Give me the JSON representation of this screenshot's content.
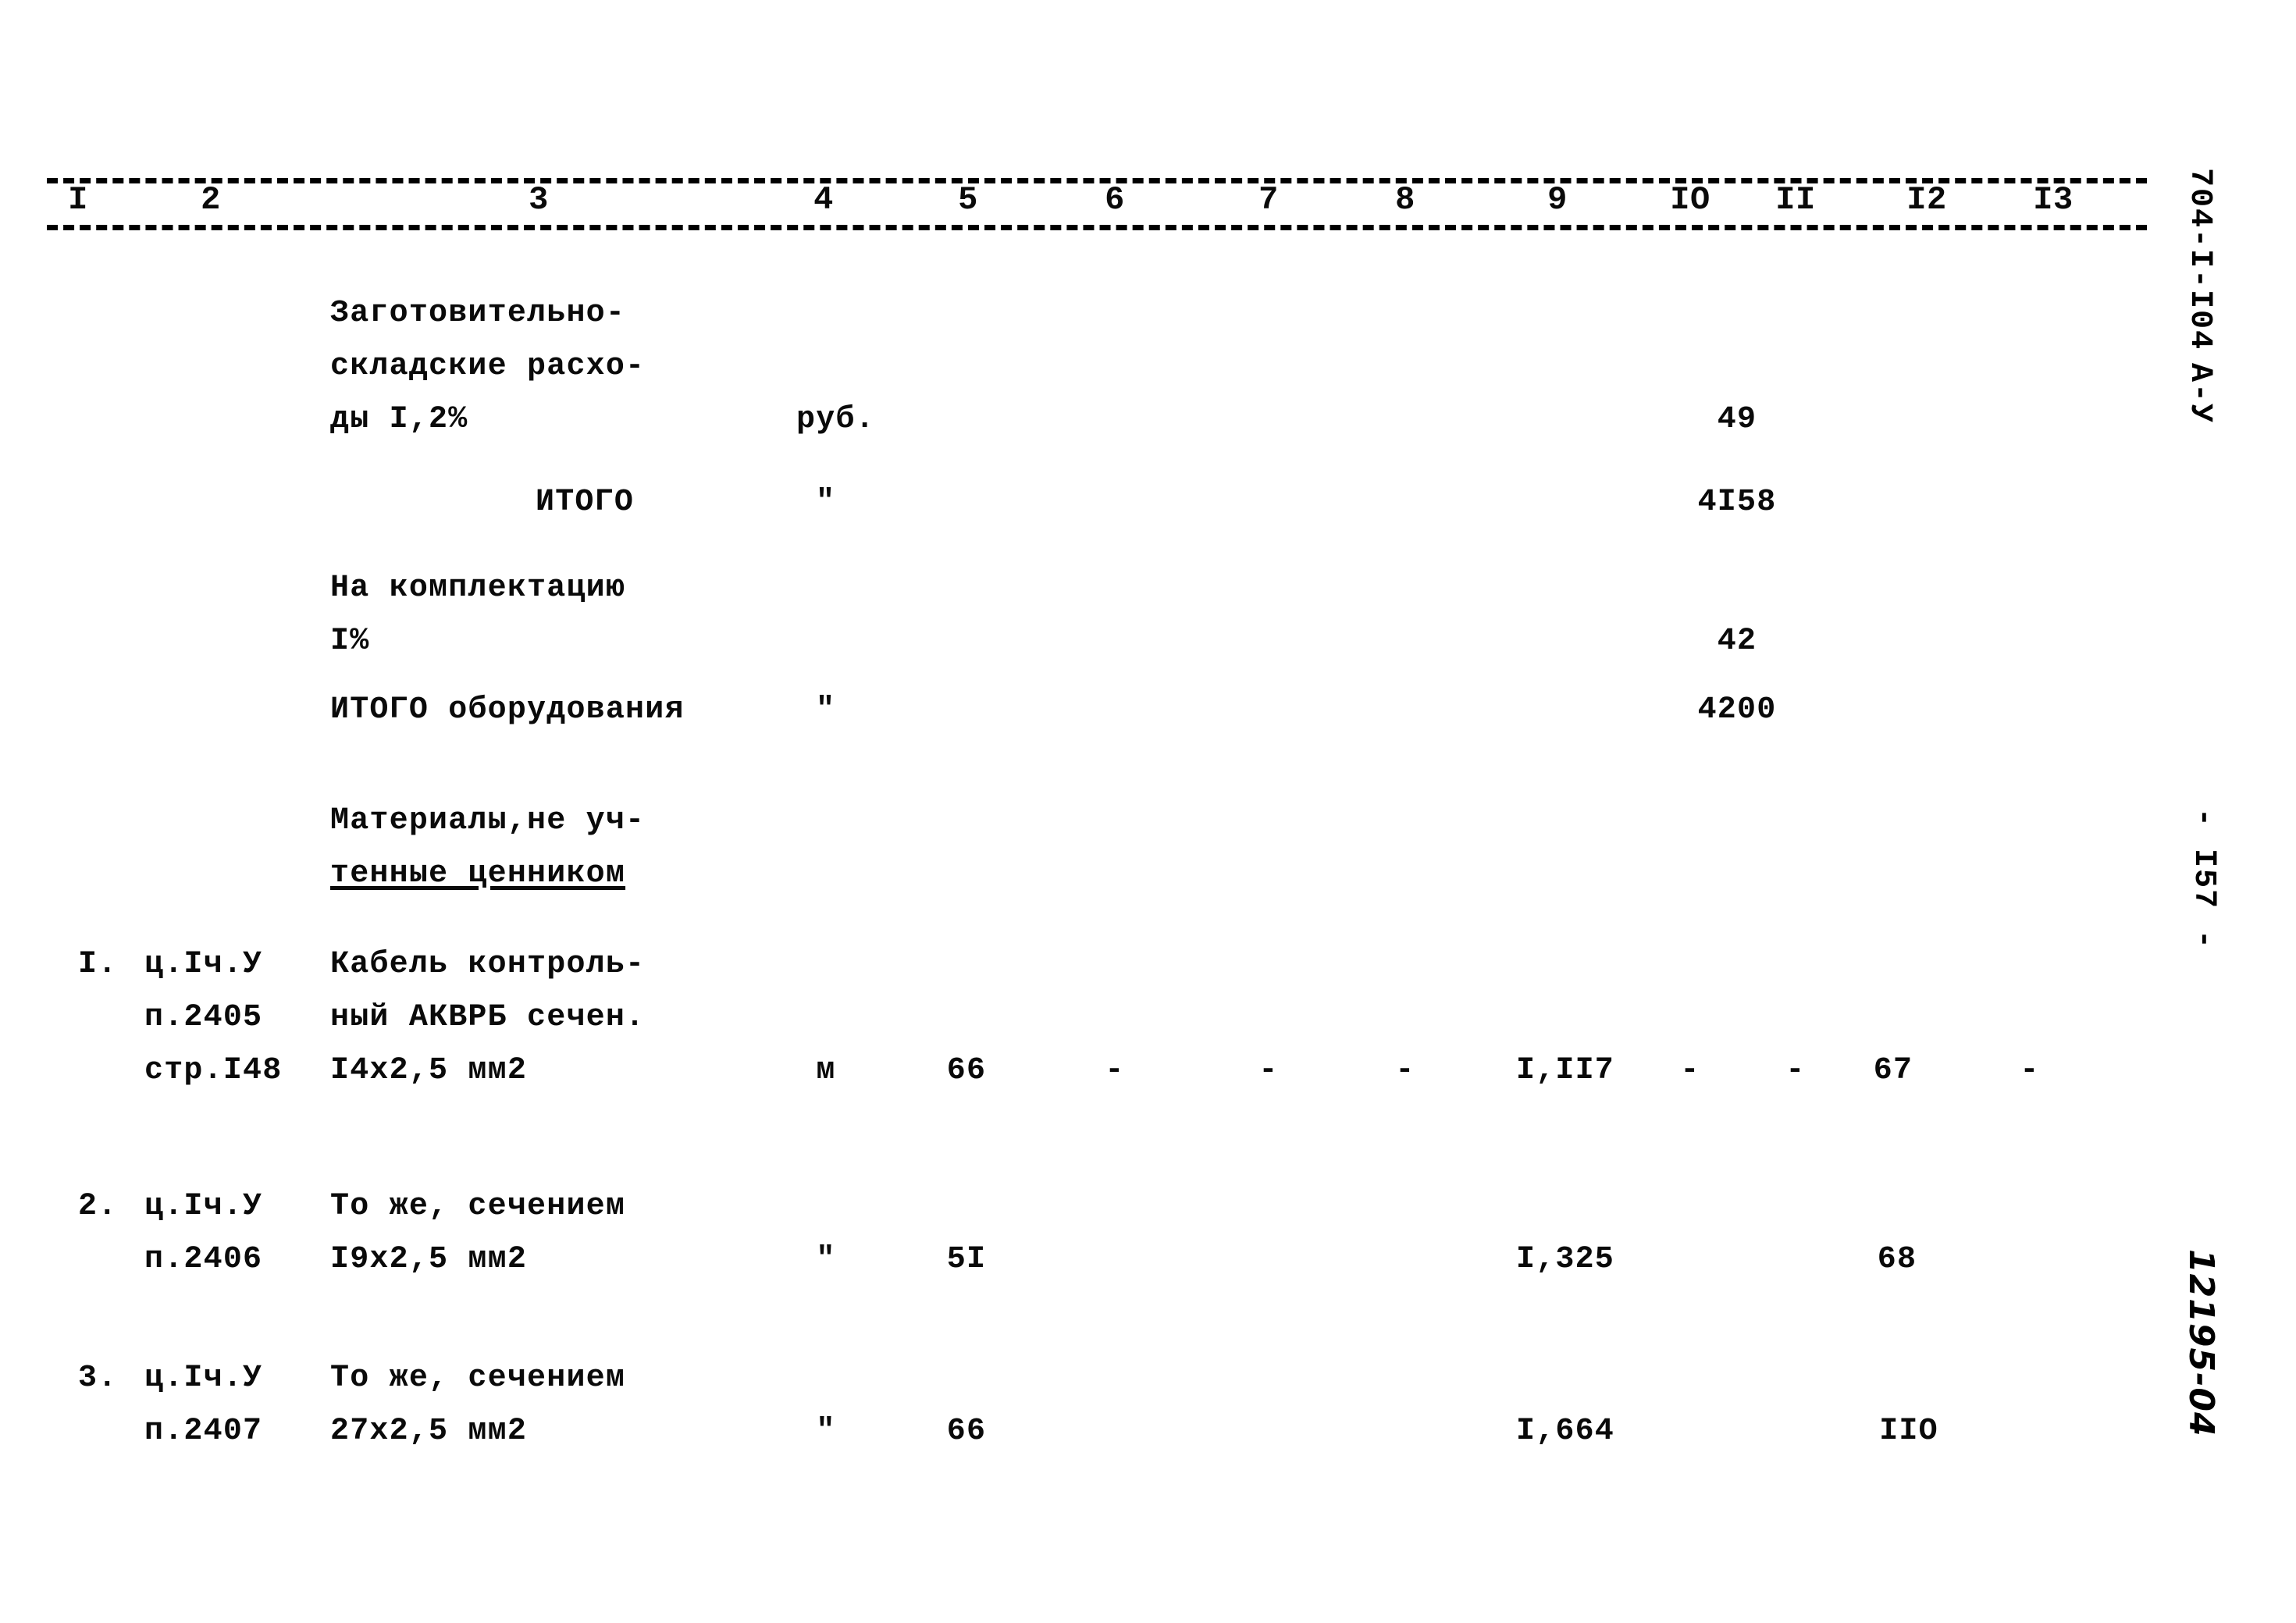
{
  "document": {
    "code": "704-I-I04",
    "code_suffix": "А-У",
    "page_marker": "- I57 -",
    "archive_number": "12195-04"
  },
  "table": {
    "column_numbers": [
      "I",
      "2",
      "3",
      "4",
      "5",
      "6",
      "7",
      "8",
      "9",
      "IO",
      "II",
      "I2",
      "I3"
    ],
    "rows": [
      {
        "kind": "text-block",
        "name_lines": [
          "Заготовительно-",
          "складские расхо-",
          "ды I,2%"
        ],
        "unit": "руб.",
        "col10": "49"
      },
      {
        "kind": "total",
        "name_lines": [
          "ИТОГО"
        ],
        "unit": "\"",
        "col10": "4I58"
      },
      {
        "kind": "text-block",
        "name_lines": [
          "На комплектацию",
          "I%"
        ],
        "unit": "",
        "col10": "42"
      },
      {
        "kind": "total",
        "name_lines": [
          "ИТОГО оборудования"
        ],
        "unit": "\"",
        "col10": "4200"
      },
      {
        "kind": "section-heading",
        "name_lines": [
          "Материалы,не уч-",
          "тенные ценником"
        ],
        "underline_last": true
      },
      {
        "kind": "item",
        "number": "I.",
        "ref_lines": [
          "ц.Iч.У",
          "п.2405",
          "стр.I48"
        ],
        "name_lines": [
          "Кабель контроль-",
          "ный АКВРБ сечен.",
          "I4х2,5 мм2"
        ],
        "unit": "м",
        "qty": "66",
        "col6": "-",
        "col7": "-",
        "col8": "-",
        "col9": "I,II7",
        "col10": "-",
        "col11": "-",
        "col12": "67",
        "col13": "-"
      },
      {
        "kind": "item",
        "number": "2.",
        "ref_lines": [
          "ц.Iч.У",
          "п.2406"
        ],
        "name_lines": [
          "То же, сечением",
          "I9х2,5 мм2"
        ],
        "unit": "\"",
        "qty": "5I",
        "col9": "I,325",
        "col12": "68"
      },
      {
        "kind": "item",
        "number": "3.",
        "ref_lines": [
          "ц.Iч.У",
          "п.2407"
        ],
        "name_lines": [
          "То же, сечением",
          "27х2,5 мм2"
        ],
        "unit": "\"",
        "qty": "66",
        "col9": "I,664",
        "col12": "IIO"
      }
    ]
  }
}
